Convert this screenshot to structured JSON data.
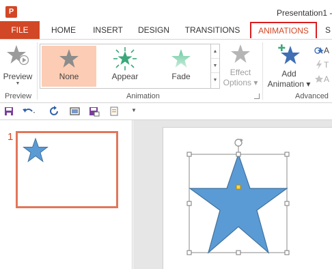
{
  "app": {
    "icon_text": "P",
    "title": "Presentation1 -"
  },
  "tabs": [
    {
      "label": "FILE"
    },
    {
      "label": "HOME"
    },
    {
      "label": "INSERT"
    },
    {
      "label": "DESIGN"
    },
    {
      "label": "TRANSITIONS"
    },
    {
      "label": "ANIMATIONS"
    },
    {
      "label": "S"
    }
  ],
  "active_tab": "ANIMATIONS",
  "ribbon": {
    "preview_group": {
      "button_label": "Preview",
      "group_label": "Preview"
    },
    "animation_group": {
      "group_label": "Animation",
      "gallery": [
        {
          "label": "None",
          "selected": true
        },
        {
          "label": "Appear",
          "selected": false
        },
        {
          "label": "Fade",
          "selected": false
        }
      ],
      "effect_options": {
        "line1": "Effect",
        "line2": "Options"
      }
    },
    "add_animation": {
      "line1": "Add",
      "line2": "Animation"
    },
    "advanced_group": {
      "group_label": "Advanced",
      "items": [
        "A",
        "T",
        "A"
      ]
    }
  },
  "slides": [
    {
      "number": "1"
    }
  ],
  "colors": {
    "accent": "#d24726",
    "highlight_border": "#d91e1e",
    "selected_item": "#fcccb4",
    "shape_fill": "#5b9bd5",
    "thumb_border": "#e2765a"
  }
}
